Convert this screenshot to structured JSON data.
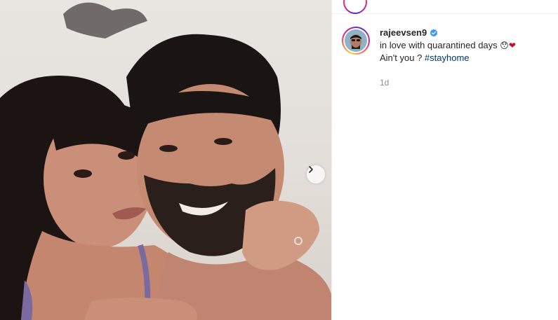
{
  "post": {
    "username": "rajeevsen9",
    "verified": true,
    "caption_line1": "in love with quarantined days",
    "caption_emoji1": "😯",
    "caption_emoji2": "❤",
    "caption_line2_prefix": "Ain't you ? ",
    "hashtag": "#stayhome",
    "time_ago": "1d"
  },
  "icons": {
    "next": "chevron-right-icon",
    "verified": "verified-badge-icon"
  },
  "colors": {
    "verified_blue": "#3897f0",
    "hashtag": "#00376b",
    "muted": "#8e8e8e",
    "heart": "#c0102b"
  }
}
